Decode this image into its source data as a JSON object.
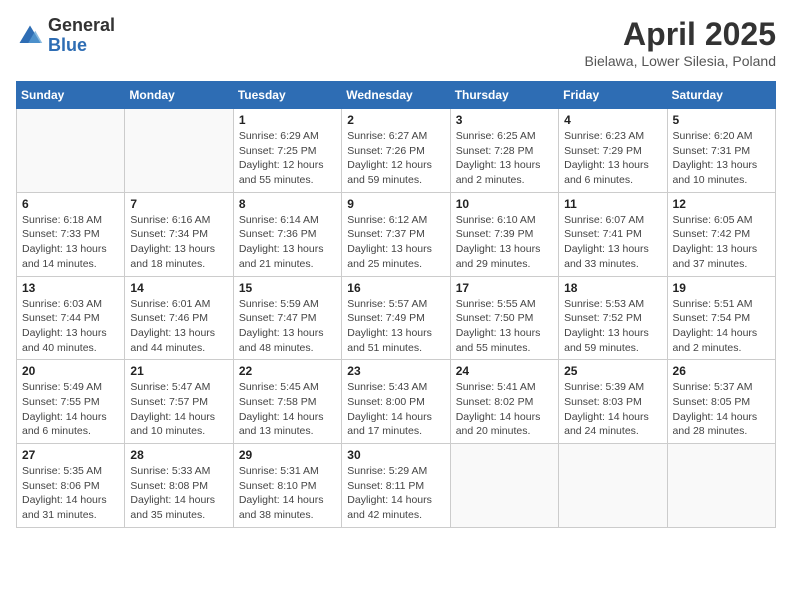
{
  "logo": {
    "general": "General",
    "blue": "Blue"
  },
  "title": {
    "month_year": "April 2025",
    "location": "Bielawa, Lower Silesia, Poland"
  },
  "weekdays": [
    "Sunday",
    "Monday",
    "Tuesday",
    "Wednesday",
    "Thursday",
    "Friday",
    "Saturday"
  ],
  "weeks": [
    [
      {
        "day": "",
        "detail": ""
      },
      {
        "day": "",
        "detail": ""
      },
      {
        "day": "1",
        "detail": "Sunrise: 6:29 AM\nSunset: 7:25 PM\nDaylight: 12 hours and 55 minutes."
      },
      {
        "day": "2",
        "detail": "Sunrise: 6:27 AM\nSunset: 7:26 PM\nDaylight: 12 hours and 59 minutes."
      },
      {
        "day": "3",
        "detail": "Sunrise: 6:25 AM\nSunset: 7:28 PM\nDaylight: 13 hours and 2 minutes."
      },
      {
        "day": "4",
        "detail": "Sunrise: 6:23 AM\nSunset: 7:29 PM\nDaylight: 13 hours and 6 minutes."
      },
      {
        "day": "5",
        "detail": "Sunrise: 6:20 AM\nSunset: 7:31 PM\nDaylight: 13 hours and 10 minutes."
      }
    ],
    [
      {
        "day": "6",
        "detail": "Sunrise: 6:18 AM\nSunset: 7:33 PM\nDaylight: 13 hours and 14 minutes."
      },
      {
        "day": "7",
        "detail": "Sunrise: 6:16 AM\nSunset: 7:34 PM\nDaylight: 13 hours and 18 minutes."
      },
      {
        "day": "8",
        "detail": "Sunrise: 6:14 AM\nSunset: 7:36 PM\nDaylight: 13 hours and 21 minutes."
      },
      {
        "day": "9",
        "detail": "Sunrise: 6:12 AM\nSunset: 7:37 PM\nDaylight: 13 hours and 25 minutes."
      },
      {
        "day": "10",
        "detail": "Sunrise: 6:10 AM\nSunset: 7:39 PM\nDaylight: 13 hours and 29 minutes."
      },
      {
        "day": "11",
        "detail": "Sunrise: 6:07 AM\nSunset: 7:41 PM\nDaylight: 13 hours and 33 minutes."
      },
      {
        "day": "12",
        "detail": "Sunrise: 6:05 AM\nSunset: 7:42 PM\nDaylight: 13 hours and 37 minutes."
      }
    ],
    [
      {
        "day": "13",
        "detail": "Sunrise: 6:03 AM\nSunset: 7:44 PM\nDaylight: 13 hours and 40 minutes."
      },
      {
        "day": "14",
        "detail": "Sunrise: 6:01 AM\nSunset: 7:46 PM\nDaylight: 13 hours and 44 minutes."
      },
      {
        "day": "15",
        "detail": "Sunrise: 5:59 AM\nSunset: 7:47 PM\nDaylight: 13 hours and 48 minutes."
      },
      {
        "day": "16",
        "detail": "Sunrise: 5:57 AM\nSunset: 7:49 PM\nDaylight: 13 hours and 51 minutes."
      },
      {
        "day": "17",
        "detail": "Sunrise: 5:55 AM\nSunset: 7:50 PM\nDaylight: 13 hours and 55 minutes."
      },
      {
        "day": "18",
        "detail": "Sunrise: 5:53 AM\nSunset: 7:52 PM\nDaylight: 13 hours and 59 minutes."
      },
      {
        "day": "19",
        "detail": "Sunrise: 5:51 AM\nSunset: 7:54 PM\nDaylight: 14 hours and 2 minutes."
      }
    ],
    [
      {
        "day": "20",
        "detail": "Sunrise: 5:49 AM\nSunset: 7:55 PM\nDaylight: 14 hours and 6 minutes."
      },
      {
        "day": "21",
        "detail": "Sunrise: 5:47 AM\nSunset: 7:57 PM\nDaylight: 14 hours and 10 minutes."
      },
      {
        "day": "22",
        "detail": "Sunrise: 5:45 AM\nSunset: 7:58 PM\nDaylight: 14 hours and 13 minutes."
      },
      {
        "day": "23",
        "detail": "Sunrise: 5:43 AM\nSunset: 8:00 PM\nDaylight: 14 hours and 17 minutes."
      },
      {
        "day": "24",
        "detail": "Sunrise: 5:41 AM\nSunset: 8:02 PM\nDaylight: 14 hours and 20 minutes."
      },
      {
        "day": "25",
        "detail": "Sunrise: 5:39 AM\nSunset: 8:03 PM\nDaylight: 14 hours and 24 minutes."
      },
      {
        "day": "26",
        "detail": "Sunrise: 5:37 AM\nSunset: 8:05 PM\nDaylight: 14 hours and 28 minutes."
      }
    ],
    [
      {
        "day": "27",
        "detail": "Sunrise: 5:35 AM\nSunset: 8:06 PM\nDaylight: 14 hours and 31 minutes."
      },
      {
        "day": "28",
        "detail": "Sunrise: 5:33 AM\nSunset: 8:08 PM\nDaylight: 14 hours and 35 minutes."
      },
      {
        "day": "29",
        "detail": "Sunrise: 5:31 AM\nSunset: 8:10 PM\nDaylight: 14 hours and 38 minutes."
      },
      {
        "day": "30",
        "detail": "Sunrise: 5:29 AM\nSunset: 8:11 PM\nDaylight: 14 hours and 42 minutes."
      },
      {
        "day": "",
        "detail": ""
      },
      {
        "day": "",
        "detail": ""
      },
      {
        "day": "",
        "detail": ""
      }
    ]
  ]
}
